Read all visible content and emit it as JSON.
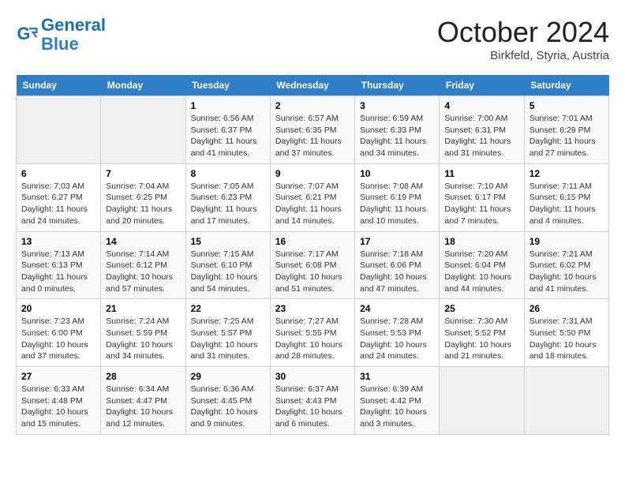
{
  "logo": {
    "line1": "General",
    "line2": "Blue"
  },
  "title": "October 2024",
  "subtitle": "Birkfeld, Styria, Austria",
  "weekdays": [
    "Sunday",
    "Monday",
    "Tuesday",
    "Wednesday",
    "Thursday",
    "Friday",
    "Saturday"
  ],
  "weeks": [
    [
      {
        "day": "",
        "empty": true
      },
      {
        "day": "",
        "empty": true
      },
      {
        "day": "1",
        "sunrise": "Sunrise: 6:56 AM",
        "sunset": "Sunset: 6:37 PM",
        "daylight": "Daylight: 11 hours and 41 minutes."
      },
      {
        "day": "2",
        "sunrise": "Sunrise: 6:57 AM",
        "sunset": "Sunset: 6:35 PM",
        "daylight": "Daylight: 11 hours and 37 minutes."
      },
      {
        "day": "3",
        "sunrise": "Sunrise: 6:59 AM",
        "sunset": "Sunset: 6:33 PM",
        "daylight": "Daylight: 11 hours and 34 minutes."
      },
      {
        "day": "4",
        "sunrise": "Sunrise: 7:00 AM",
        "sunset": "Sunset: 6:31 PM",
        "daylight": "Daylight: 11 hours and 31 minutes."
      },
      {
        "day": "5",
        "sunrise": "Sunrise: 7:01 AM",
        "sunset": "Sunset: 6:29 PM",
        "daylight": "Daylight: 11 hours and 27 minutes."
      }
    ],
    [
      {
        "day": "6",
        "sunrise": "Sunrise: 7:03 AM",
        "sunset": "Sunset: 6:27 PM",
        "daylight": "Daylight: 11 hours and 24 minutes."
      },
      {
        "day": "7",
        "sunrise": "Sunrise: 7:04 AM",
        "sunset": "Sunset: 6:25 PM",
        "daylight": "Daylight: 11 hours and 20 minutes."
      },
      {
        "day": "8",
        "sunrise": "Sunrise: 7:05 AM",
        "sunset": "Sunset: 6:23 PM",
        "daylight": "Daylight: 11 hours and 17 minutes."
      },
      {
        "day": "9",
        "sunrise": "Sunrise: 7:07 AM",
        "sunset": "Sunset: 6:21 PM",
        "daylight": "Daylight: 11 hours and 14 minutes."
      },
      {
        "day": "10",
        "sunrise": "Sunrise: 7:08 AM",
        "sunset": "Sunset: 6:19 PM",
        "daylight": "Daylight: 11 hours and 10 minutes."
      },
      {
        "day": "11",
        "sunrise": "Sunrise: 7:10 AM",
        "sunset": "Sunset: 6:17 PM",
        "daylight": "Daylight: 11 hours and 7 minutes."
      },
      {
        "day": "12",
        "sunrise": "Sunrise: 7:11 AM",
        "sunset": "Sunset: 6:15 PM",
        "daylight": "Daylight: 11 hours and 4 minutes."
      }
    ],
    [
      {
        "day": "13",
        "sunrise": "Sunrise: 7:13 AM",
        "sunset": "Sunset: 6:13 PM",
        "daylight": "Daylight: 11 hours and 0 minutes."
      },
      {
        "day": "14",
        "sunrise": "Sunrise: 7:14 AM",
        "sunset": "Sunset: 6:12 PM",
        "daylight": "Daylight: 10 hours and 57 minutes."
      },
      {
        "day": "15",
        "sunrise": "Sunrise: 7:15 AM",
        "sunset": "Sunset: 6:10 PM",
        "daylight": "Daylight: 10 hours and 54 minutes."
      },
      {
        "day": "16",
        "sunrise": "Sunrise: 7:17 AM",
        "sunset": "Sunset: 6:08 PM",
        "daylight": "Daylight: 10 hours and 51 minutes."
      },
      {
        "day": "17",
        "sunrise": "Sunrise: 7:18 AM",
        "sunset": "Sunset: 6:06 PM",
        "daylight": "Daylight: 10 hours and 47 minutes."
      },
      {
        "day": "18",
        "sunrise": "Sunrise: 7:20 AM",
        "sunset": "Sunset: 6:04 PM",
        "daylight": "Daylight: 10 hours and 44 minutes."
      },
      {
        "day": "19",
        "sunrise": "Sunrise: 7:21 AM",
        "sunset": "Sunset: 6:02 PM",
        "daylight": "Daylight: 10 hours and 41 minutes."
      }
    ],
    [
      {
        "day": "20",
        "sunrise": "Sunrise: 7:23 AM",
        "sunset": "Sunset: 6:00 PM",
        "daylight": "Daylight: 10 hours and 37 minutes."
      },
      {
        "day": "21",
        "sunrise": "Sunrise: 7:24 AM",
        "sunset": "Sunset: 5:59 PM",
        "daylight": "Daylight: 10 hours and 34 minutes."
      },
      {
        "day": "22",
        "sunrise": "Sunrise: 7:25 AM",
        "sunset": "Sunset: 5:57 PM",
        "daylight": "Daylight: 10 hours and 31 minutes."
      },
      {
        "day": "23",
        "sunrise": "Sunrise: 7:27 AM",
        "sunset": "Sunset: 5:55 PM",
        "daylight": "Daylight: 10 hours and 28 minutes."
      },
      {
        "day": "24",
        "sunrise": "Sunrise: 7:28 AM",
        "sunset": "Sunset: 5:53 PM",
        "daylight": "Daylight: 10 hours and 24 minutes."
      },
      {
        "day": "25",
        "sunrise": "Sunrise: 7:30 AM",
        "sunset": "Sunset: 5:52 PM",
        "daylight": "Daylight: 10 hours and 21 minutes."
      },
      {
        "day": "26",
        "sunrise": "Sunrise: 7:31 AM",
        "sunset": "Sunset: 5:50 PM",
        "daylight": "Daylight: 10 hours and 18 minutes."
      }
    ],
    [
      {
        "day": "27",
        "sunrise": "Sunrise: 6:33 AM",
        "sunset": "Sunset: 4:48 PM",
        "daylight": "Daylight: 10 hours and 15 minutes."
      },
      {
        "day": "28",
        "sunrise": "Sunrise: 6:34 AM",
        "sunset": "Sunset: 4:47 PM",
        "daylight": "Daylight: 10 hours and 12 minutes."
      },
      {
        "day": "29",
        "sunrise": "Sunrise: 6:36 AM",
        "sunset": "Sunset: 4:45 PM",
        "daylight": "Daylight: 10 hours and 9 minutes."
      },
      {
        "day": "30",
        "sunrise": "Sunrise: 6:37 AM",
        "sunset": "Sunset: 4:43 PM",
        "daylight": "Daylight: 10 hours and 6 minutes."
      },
      {
        "day": "31",
        "sunrise": "Sunrise: 6:39 AM",
        "sunset": "Sunset: 4:42 PM",
        "daylight": "Daylight: 10 hours and 3 minutes."
      },
      {
        "day": "",
        "empty": true
      },
      {
        "day": "",
        "empty": true
      }
    ]
  ]
}
